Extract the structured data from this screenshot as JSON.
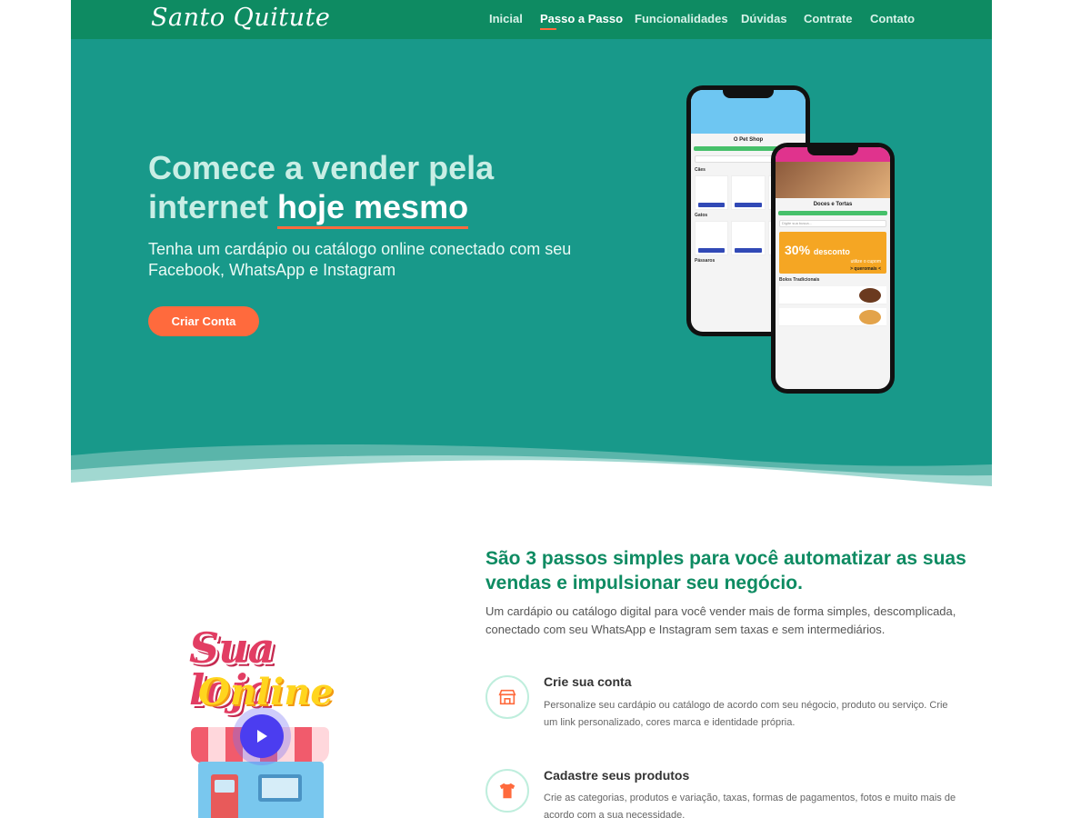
{
  "nav": {
    "logo": "Santo Quitute",
    "items": [
      {
        "label": "Inicial"
      },
      {
        "label": "Passo a Passo"
      },
      {
        "label": "Funcionalidades"
      },
      {
        "label": "Dúvidas"
      },
      {
        "label": "Contrate"
      },
      {
        "label": "Contato"
      }
    ],
    "active_item": "Passo a Passo"
  },
  "hero": {
    "title_part1": "Comece a vender pela internet ",
    "title_highlight": "hoje mesmo",
    "subtitle": "Tenha um cardápio ou catálogo online conectado com seu Facebook, WhatsApp e Instagram",
    "cta_label": "Criar Conta"
  },
  "phone_mockups": {
    "phone1_shop": "O Pet Shop",
    "phone1_section_a": "Cães",
    "phone1_section_b": "Gatos",
    "phone1_section_c": "Pássaros",
    "phone2_shop": "Doces e Tortas",
    "phone2_search": "Digite sua busca...",
    "phone2_promo_pct": "30%",
    "phone2_promo_word": "desconto",
    "phone2_promo_sub": "utilize o cupom",
    "phone2_promo_code": "> queromais <",
    "phone2_section": "Bolos Tradicionais"
  },
  "illustration": {
    "line1": "Sua loja",
    "line2": "Online"
  },
  "steps_section": {
    "title": "São 3 passos simples para você automatizar as suas vendas e impulsionar seu negócio.",
    "description": "Um cardápio ou catálogo digital para você vender mais de forma simples, descomplicada, conectado com seu WhatsApp e Instagram sem taxas e sem intermediários.",
    "steps": [
      {
        "icon": "store-icon",
        "title": "Crie sua conta",
        "text": "Personalize seu cardápio ou catálogo de acordo com seu négocio, produto ou serviço. Crie um link personalizado, cores marca e identidade própria."
      },
      {
        "icon": "tshirt-icon",
        "title": "Cadastre seus produtos",
        "text": "Crie as categorias, produtos e variação, taxas, formas de pagamentos, fotos e muito mais de acordo com a sua necessidade."
      }
    ]
  },
  "colors": {
    "nav_bg": "#0e8b62",
    "hero_bg": "#18998a",
    "accent": "#ff6a3d",
    "heading_green": "#0e8b62"
  }
}
